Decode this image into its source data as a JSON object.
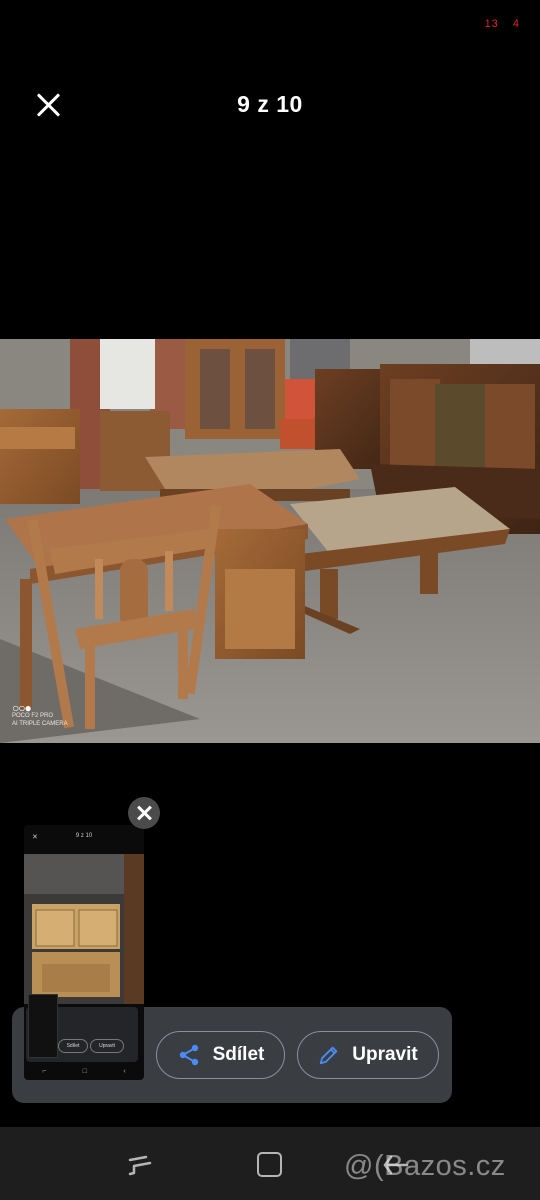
{
  "status_bar": {
    "left_number": "13",
    "right_number": "4"
  },
  "header": {
    "counter": "9 z 10"
  },
  "photo": {
    "watermark_line1": "POCO F2 PRO",
    "watermark_line2": "AI TRIPLE CAMERA"
  },
  "screenshot_thumbnail": {
    "counter": "9 z 10"
  },
  "share_sheet": {
    "share_label": "Sdílet",
    "edit_label": "Upravit"
  },
  "overlay": {
    "watermark": "@(Bazos.cz"
  },
  "colors": {
    "status_red": "#e0262b",
    "share_bar": "#3a3d42",
    "pill_border": "#8d9096",
    "icon_blue": "#4a8cf7"
  },
  "icons": [
    "close-icon",
    "share-icon",
    "pencil-icon",
    "recent-apps-icon",
    "home-icon",
    "back-icon"
  ]
}
